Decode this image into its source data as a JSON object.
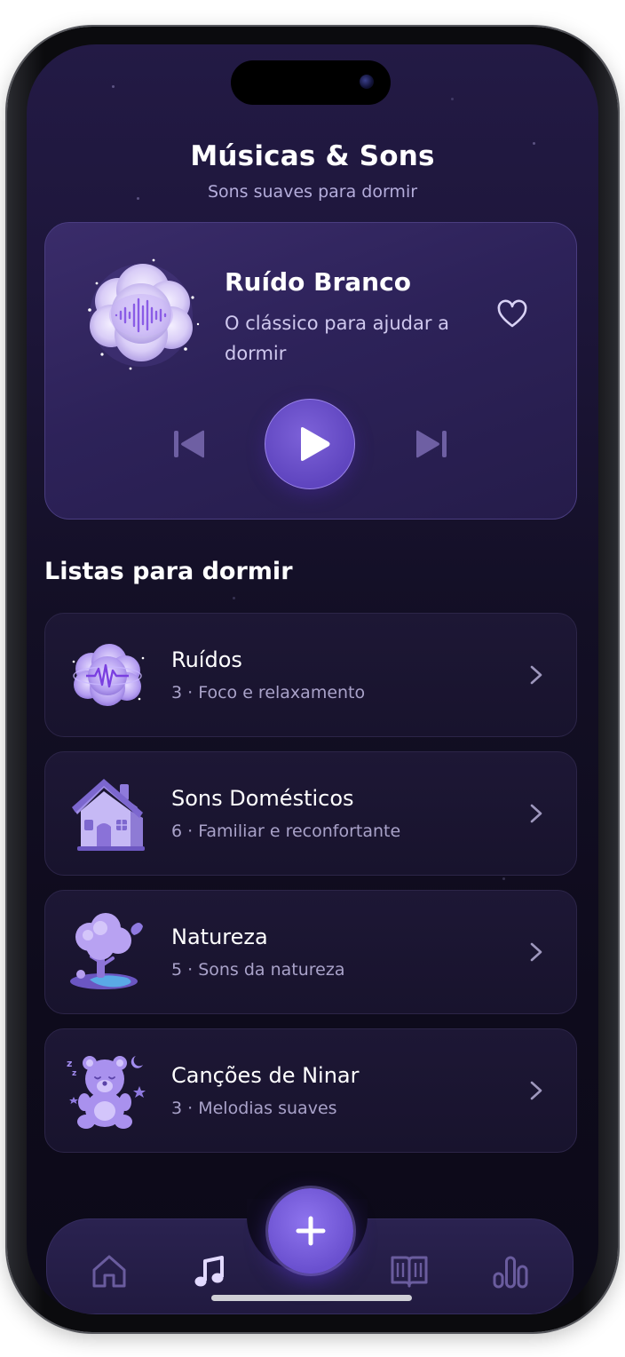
{
  "header": {
    "title": "Músicas & Sons",
    "subtitle": "Sons suaves para dormir"
  },
  "player": {
    "title": "Ruído Branco",
    "description": "O clássico para ajudar a dormir",
    "icons": [
      "white-noise-cloud-art",
      "heart-icon",
      "skip-previous-icon",
      "play-icon",
      "skip-next-icon"
    ]
  },
  "playlists": {
    "section_title": "Listas para dormir",
    "items": [
      {
        "title": "Ruídos",
        "subtitle": "3 · Foco e relaxamento",
        "icon": "noise-cloud-art"
      },
      {
        "title": "Sons Domésticos",
        "subtitle": "6 · Familiar e reconfortante",
        "icon": "house-art"
      },
      {
        "title": "Natureza",
        "subtitle": "5 · Sons da natureza",
        "icon": "tree-art"
      },
      {
        "title": "Canções de Ninar",
        "subtitle": "3 · Melodias suaves",
        "icon": "teddy-bear-art"
      }
    ]
  },
  "nav": {
    "items": [
      "home-icon",
      "music-icon",
      "add-icon",
      "book-icon",
      "stats-icon"
    ],
    "active": "music-icon"
  },
  "colors": {
    "accent": "#6a50cf",
    "background": "#130f25",
    "card": "#2d2259",
    "text_secondary": "#a9a2c9"
  }
}
